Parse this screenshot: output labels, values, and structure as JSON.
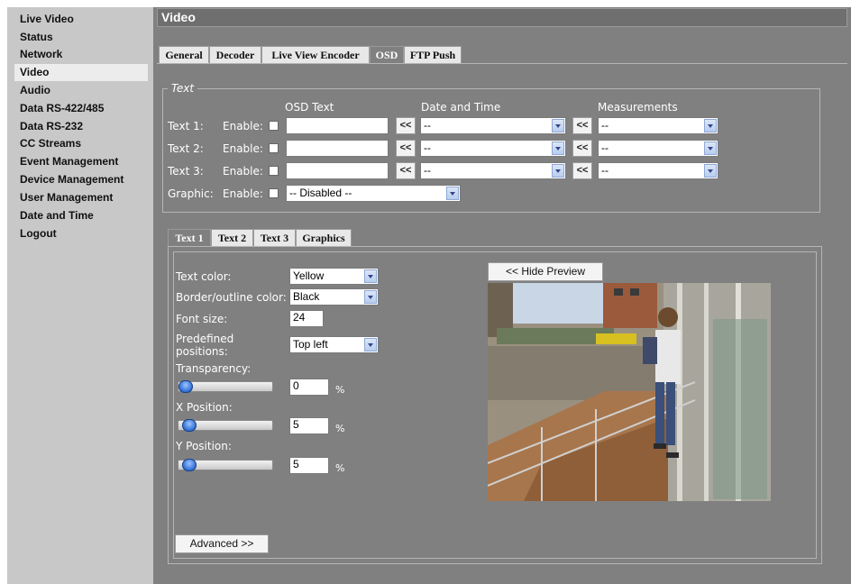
{
  "sidebar": {
    "items": [
      {
        "label": "Live Video"
      },
      {
        "label": "Status"
      },
      {
        "label": "Network"
      },
      {
        "label": "Video",
        "active": true
      },
      {
        "label": "Audio"
      },
      {
        "label": "Data RS-422/485"
      },
      {
        "label": "Data RS-232"
      },
      {
        "label": "CC Streams"
      },
      {
        "label": "Event Management"
      },
      {
        "label": "Device Management"
      },
      {
        "label": "User Management"
      },
      {
        "label": "Date and Time"
      },
      {
        "label": "Logout"
      }
    ]
  },
  "page": {
    "title": "Video"
  },
  "tabs": [
    {
      "label": "General"
    },
    {
      "label": "Decoder"
    },
    {
      "label": "Live View Encoder"
    },
    {
      "label": "OSD",
      "active": true
    },
    {
      "label": "FTP Push"
    }
  ],
  "text_section": {
    "legend": "Text",
    "headers": {
      "osd_text": "OSD Text",
      "date_time": "Date and Time",
      "measurements": "Measurements"
    },
    "rows": [
      {
        "label": "Text 1:",
        "enable_label": "Enable:",
        "osd_text": "",
        "append_label": "<<",
        "date_time": "--",
        "measurements": "--"
      },
      {
        "label": "Text 2:",
        "enable_label": "Enable:",
        "osd_text": "",
        "append_label": "<<",
        "date_time": "--",
        "measurements": "--"
      },
      {
        "label": "Text 3:",
        "enable_label": "Enable:",
        "osd_text": "",
        "append_label": "<<",
        "date_time": "--",
        "measurements": "--"
      }
    ],
    "graphic": {
      "label": "Graphic:",
      "enable_label": "Enable:",
      "value": "-- Disabled --"
    }
  },
  "subtabs": [
    {
      "label": "Text 1",
      "active": true
    },
    {
      "label": "Text 2"
    },
    {
      "label": "Text 3"
    },
    {
      "label": "Graphics"
    }
  ],
  "settings": {
    "text_color_label": "Text color:",
    "text_color": "Yellow",
    "border_color_label": "Border/outline color:",
    "border_color": "Black",
    "font_size_label": "Font size:",
    "font_size": "24",
    "predefined_label_1": "Predefined",
    "predefined_label_2": "positions:",
    "predefined_position": "Top left",
    "transparency_label": "Transparency:",
    "transparency": "0",
    "x_position_label": "X Position:",
    "x_position": "5",
    "y_position_label": "Y Position:",
    "y_position": "5",
    "percent_unit": "%",
    "advanced_label": "Advanced >>",
    "hide_preview_label": "<< Hide Preview"
  },
  "colors": {
    "sidebar_bg": "#c8c8c8",
    "main_bg": "#808080",
    "active_item_bg": "#ececec",
    "title_text": "#ffffff"
  }
}
